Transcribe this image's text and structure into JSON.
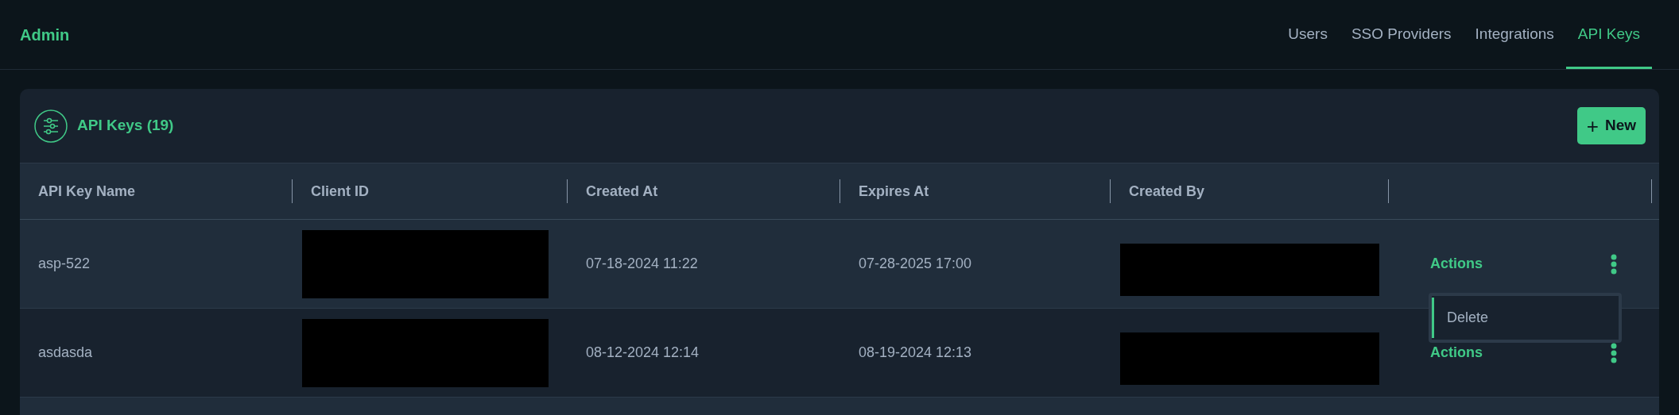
{
  "app_title": "Admin",
  "tabs": [
    {
      "label": "Users",
      "selected": false
    },
    {
      "label": "SSO Providers",
      "selected": false
    },
    {
      "label": "Integrations",
      "selected": false
    },
    {
      "label": "API Keys",
      "selected": true
    }
  ],
  "panel": {
    "title": "API Keys (19)",
    "new_button": {
      "icon": "+",
      "label": "New"
    }
  },
  "table": {
    "columns": [
      "API Key Name",
      "Client ID",
      "Created At",
      "Expires At",
      "Created By"
    ],
    "rows": [
      {
        "highlighted": true,
        "cells": [
          {
            "kind": "text",
            "text": "asp-522"
          },
          {
            "kind": "redacted"
          },
          {
            "kind": "text",
            "text": "07-18-2024 11:22"
          },
          {
            "kind": "text",
            "text": "07-28-2025 17:00"
          },
          {
            "kind": "redacted"
          }
        ],
        "action": "Actions",
        "menu_open": true,
        "menu_items": [
          "Delete"
        ]
      },
      {
        "highlighted": false,
        "cells": [
          {
            "kind": "text",
            "text": "asdasda"
          },
          {
            "kind": "redacted"
          },
          {
            "kind": "text",
            "text": "08-12-2024 12:14"
          },
          {
            "kind": "text",
            "text": "08-19-2024 12:13"
          },
          {
            "kind": "redacted"
          }
        ],
        "action": "Actions",
        "menu_open": false
      }
    ]
  }
}
